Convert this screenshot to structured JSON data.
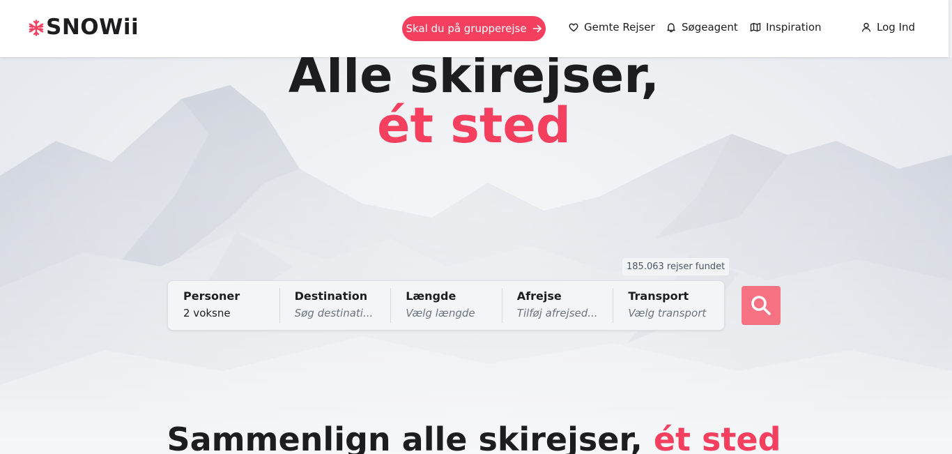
{
  "brand": {
    "name": "SNOWii",
    "accent_color": "#f43f5e",
    "icon": "snowflake-icon"
  },
  "header": {
    "group_trip_label": "Skal du på grupperejse",
    "nav": [
      {
        "label": "Gemte Rejser",
        "icon": "heart-icon"
      },
      {
        "label": "Søgeagent",
        "icon": "bell-icon"
      },
      {
        "label": "Inspiration",
        "icon": "map-icon"
      },
      {
        "label": "Log Ind",
        "icon": "user-icon"
      }
    ]
  },
  "hero": {
    "headline": "Alle skirejser,",
    "headline_accent": "ét sted",
    "results_count": "185.063 rejser fundet"
  },
  "search": {
    "fields": [
      {
        "label": "Personer",
        "value": "2 voksne",
        "filled": true
      },
      {
        "label": "Destination",
        "value": "Søg destinati...",
        "filled": false
      },
      {
        "label": "Længde",
        "value": "Vælg længde",
        "filled": false
      },
      {
        "label": "Afrejse",
        "value": "Tilføj afrejsed...",
        "filled": false
      },
      {
        "label": "Transport",
        "value": "Vælg transport",
        "filled": false
      }
    ],
    "button_icon": "search-icon",
    "button_color": "#f47282"
  },
  "section": {
    "title": "Sammenlign alle skirejser,",
    "title_accent": "ét sted"
  }
}
